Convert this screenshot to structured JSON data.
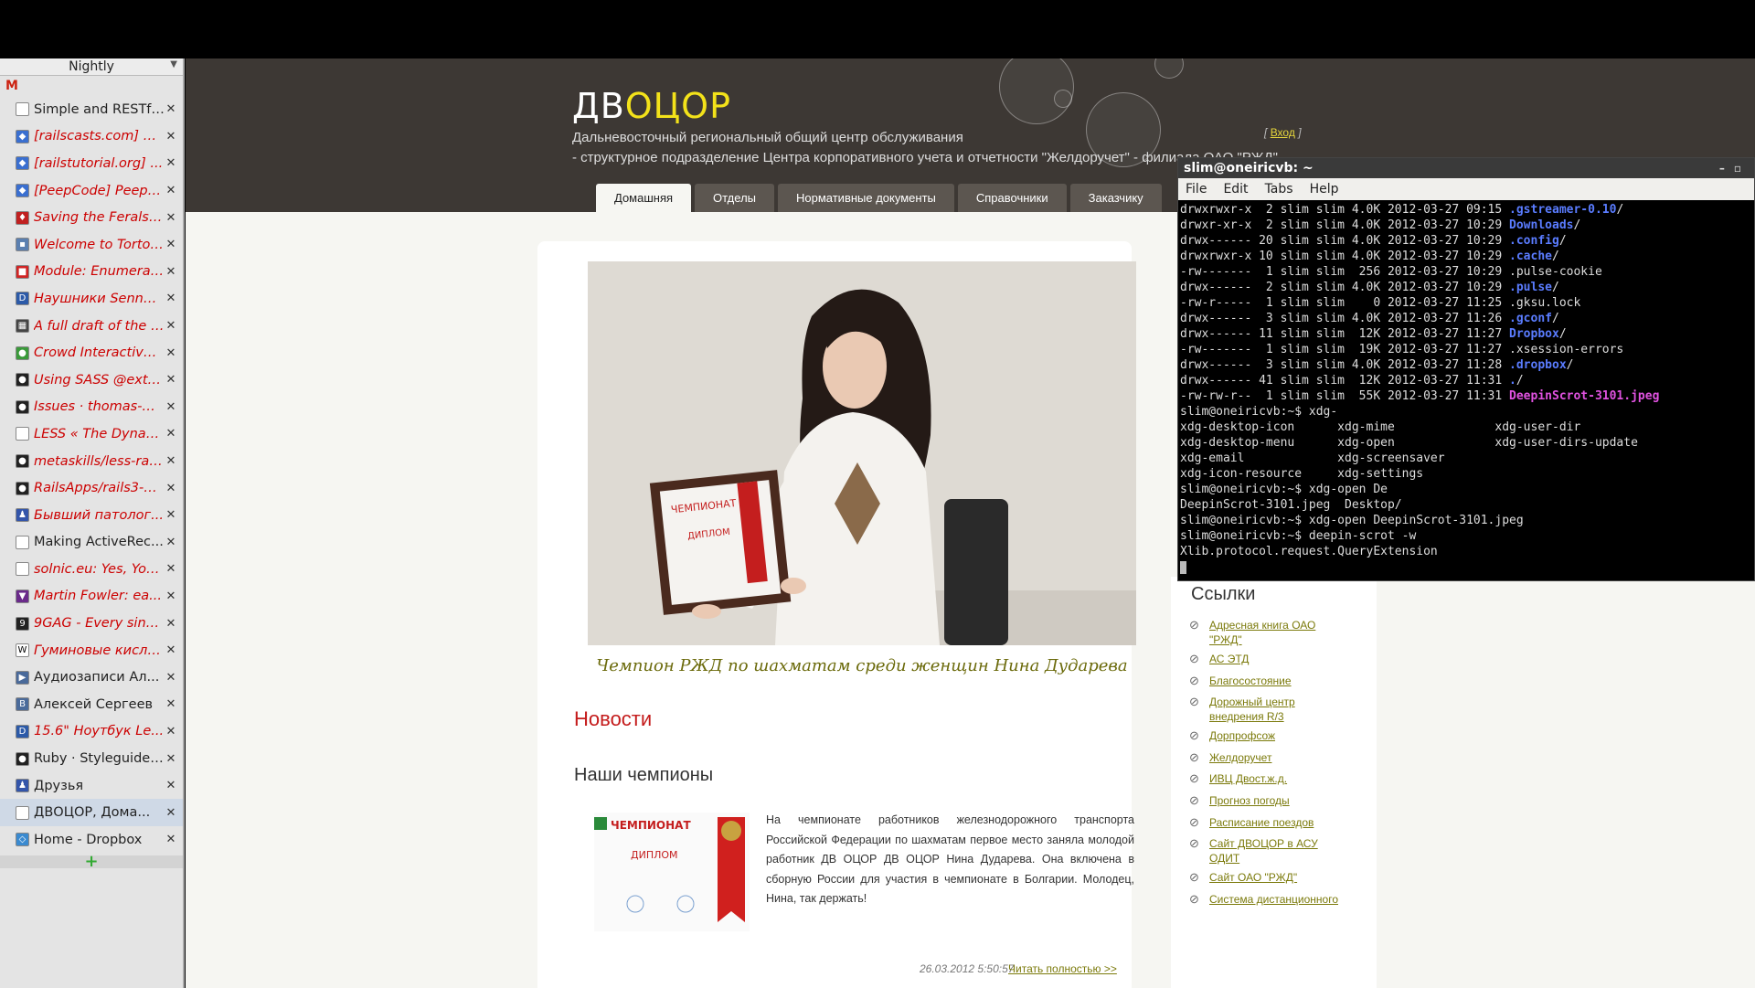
{
  "sidebar": {
    "header": "Nightly",
    "tabs": [
      {
        "title": "Simple and RESTful...",
        "italic": false,
        "icon": "page-icon",
        "color": "#ffffff"
      },
      {
        "title": "[railscasts.com] Ra...",
        "italic": true,
        "icon": "ruby-icon",
        "color": "#3a6fd0"
      },
      {
        "title": "[railstutorial.org] ...",
        "italic": true,
        "icon": "ruby-icon",
        "color": "#3a6fd0"
      },
      {
        "title": "[PeepCode] Peepc...",
        "italic": true,
        "icon": "ruby-icon",
        "color": "#3a6fd0"
      },
      {
        "title": "Saving the Ferals ...",
        "italic": true,
        "icon": "ferals-icon",
        "color": "#c02020"
      },
      {
        "title": "Welcome to Tortoi...",
        "italic": true,
        "icon": "tortoise-icon",
        "color": "#5a7fb0"
      },
      {
        "title": "Module: Enumerab...",
        "italic": true,
        "icon": "module-icon",
        "color": "#d02525"
      },
      {
        "title": "Наушники Sennhe...",
        "italic": true,
        "icon": "dns-icon",
        "color": "#2c5aa8"
      },
      {
        "title": "A full draft of the R...",
        "italic": true,
        "icon": "grid-icon",
        "color": "#444444"
      },
      {
        "title": "Crowd Interactive ...",
        "italic": true,
        "icon": "globe-icon",
        "color": "#3a9a3a"
      },
      {
        "title": "Using SASS @exte...",
        "italic": true,
        "icon": "github-icon",
        "color": "#222222"
      },
      {
        "title": "Issues · thomas-mc...",
        "italic": true,
        "icon": "github-icon",
        "color": "#222222"
      },
      {
        "title": "LESS « The Dynami...",
        "italic": true,
        "icon": "page-icon",
        "color": "#ffffff"
      },
      {
        "title": "metaskills/less-rail...",
        "italic": true,
        "icon": "github-icon",
        "color": "#222222"
      },
      {
        "title": "RailsApps/rails3-d...",
        "italic": true,
        "icon": "github-icon",
        "color": "#222222"
      },
      {
        "title": "Бывший патолог...",
        "italic": true,
        "icon": "user-icon",
        "color": "#3355aa"
      },
      {
        "title": "Making ActiveRec...",
        "italic": false,
        "icon": "page-icon",
        "color": "#ffffff"
      },
      {
        "title": "solnic.eu: Yes, You ...",
        "italic": true,
        "icon": "page-icon",
        "color": "#ffffff"
      },
      {
        "title": "Martin Fowler: ea...",
        "italic": true,
        "icon": "fowler-icon",
        "color": "#6a2a8a"
      },
      {
        "title": "9GAG - Every singl...",
        "italic": true,
        "icon": "9gag-icon",
        "color": "#222222"
      },
      {
        "title": "Гуминовые кисло...",
        "italic": true,
        "icon": "wikipedia-icon",
        "color": "#ffffff"
      },
      {
        "title": "Аудиозаписи Ал...",
        "italic": false,
        "icon": "audio-icon",
        "color": "#4a6a9a"
      },
      {
        "title": "Алексей Сергеев",
        "italic": false,
        "icon": "vk-icon",
        "color": "#4a6a9a"
      },
      {
        "title": "15.6\" Ноутбук Le...",
        "italic": true,
        "icon": "dns-icon",
        "color": "#2c5aa8"
      },
      {
        "title": "Ruby · Styleguide ...",
        "italic": false,
        "icon": "github-icon",
        "color": "#222222"
      },
      {
        "title": "Друзья",
        "italic": false,
        "icon": "user-icon",
        "color": "#3355aa"
      },
      {
        "title": "ДВОЦОР, Дома...",
        "italic": false,
        "icon": "page-icon",
        "color": "#ffffff",
        "active": true
      },
      {
        "title": "Home - Dropbox",
        "italic": false,
        "icon": "dropbox-icon",
        "color": "#3a8ad0"
      }
    ],
    "add_label": "+"
  },
  "site": {
    "title_white": "ДВ",
    "title_yellow": "ОЦОР",
    "subtitle1": "Дальневосточный региональный общий центр обслуживания",
    "subtitle2": "- структурное подразделение Центра корпоративного учета и отчетности \"Желдоручет\" - филиала ОАО \"РЖД\"",
    "login_prefix": "[",
    "login": "Вход",
    "login_suffix": "]",
    "nav": [
      "Домашняя",
      "Отделы",
      "Нормативные документы",
      "Справочники",
      "Заказчику"
    ]
  },
  "content": {
    "caption": "Чемпион РЖД по шахматам среди женщин Нина Дударева",
    "news_heading": "Новости",
    "article_title": "Наши чемпионы",
    "article_text": "На чемпионате работников железнодорожного транспорта Российской Федерации по шахматам первое место заняла молодой работник ДВ ОЦОР ДВ ОЦОР Нина Дударева. Она включена в сборную России для участия в чемпионате в Болгарии. Молодец, Нина, так держать!",
    "date": "26.03.2012 5:50:57",
    "read_more": "Читать полностью >>",
    "diploma_title": "ЧЕМПИОНАТ",
    "diploma_label": "ДИПЛОМ"
  },
  "links": {
    "heading": "Ссылки",
    "items": [
      "Адресная книга ОАО \"РЖД\"",
      "АС ЭТД",
      "Благосостояние",
      "Дорожный центр внедрения R/3",
      "Дорпрофсож",
      "Желдоручет",
      "ИВЦ Двост.ж.д.",
      "Прогноз погоды",
      "Расписание поездов",
      "Сайт ДВОЦОР в АСУ ОДИТ",
      "Сайт ОАО \"РЖД\"",
      "Система дистанционного"
    ]
  },
  "terminal": {
    "title": "slim@oneiricvb: ~",
    "menu": [
      "File",
      "Edit",
      "Tabs",
      "Help"
    ],
    "lines": [
      {
        "pre": "drwxrwxr-x  2 slim slim 4.0K 2012-03-27 09:15 ",
        "name": ".gstreamer-0.10",
        "cls": "dirc",
        "post": "/"
      },
      {
        "pre": "drwxr-xr-x  2 slim slim 4.0K 2012-03-27 10:29 ",
        "name": "Downloads",
        "cls": "dirc",
        "post": "/"
      },
      {
        "pre": "drwx------ 20 slim slim 4.0K 2012-03-27 10:29 ",
        "name": ".config",
        "cls": "dirc",
        "post": "/"
      },
      {
        "pre": "drwxrwxr-x 10 slim slim 4.0K 2012-03-27 10:29 ",
        "name": ".cache",
        "cls": "dirc",
        "post": "/"
      },
      {
        "pre": "-rw-------  1 slim slim  256 2012-03-27 10:29 .pulse-cookie",
        "name": "",
        "cls": "",
        "post": ""
      },
      {
        "pre": "drwx------  2 slim slim 4.0K 2012-03-27 10:29 ",
        "name": ".pulse",
        "cls": "dirc",
        "post": "/"
      },
      {
        "pre": "-rw-r-----  1 slim slim    0 2012-03-27 11:25 .gksu.lock",
        "name": "",
        "cls": "",
        "post": ""
      },
      {
        "pre": "drwx------  3 slim slim 4.0K 2012-03-27 11:26 ",
        "name": ".gconf",
        "cls": "dirc",
        "post": "/"
      },
      {
        "pre": "drwx------ 11 slim slim  12K 2012-03-27 11:27 ",
        "name": "Dropbox",
        "cls": "dirc",
        "post": "/"
      },
      {
        "pre": "-rw-------  1 slim slim  19K 2012-03-27 11:27 .xsession-errors",
        "name": "",
        "cls": "",
        "post": ""
      },
      {
        "pre": "drwx------  3 slim slim 4.0K 2012-03-27 11:28 ",
        "name": ".dropbox",
        "cls": "dirc",
        "post": "/"
      },
      {
        "pre": "drwx------ 41 slim slim  12K 2012-03-27 11:31 ",
        "name": ".",
        "cls": "dirc",
        "post": "/"
      },
      {
        "pre": "-rw-rw-r--  1 slim slim  55K 2012-03-27 11:31 ",
        "name": "DeepinScrot-3101.jpeg",
        "cls": "imgc",
        "post": ""
      },
      {
        "pre": "slim@oneiricvb:~$ xdg-",
        "name": "",
        "cls": "",
        "post": ""
      },
      {
        "pre": "xdg-desktop-icon      xdg-mime              xdg-user-dir",
        "name": "",
        "cls": "",
        "post": ""
      },
      {
        "pre": "xdg-desktop-menu      xdg-open              xdg-user-dirs-update",
        "name": "",
        "cls": "",
        "post": ""
      },
      {
        "pre": "xdg-email             xdg-screensaver",
        "name": "",
        "cls": "",
        "post": ""
      },
      {
        "pre": "xdg-icon-resource     xdg-settings",
        "name": "",
        "cls": "",
        "post": ""
      },
      {
        "pre": "slim@oneiricvb:~$ xdg-open De",
        "name": "",
        "cls": "",
        "post": ""
      },
      {
        "pre": "DeepinScrot-3101.jpeg  Desktop/",
        "name": "",
        "cls": "",
        "post": ""
      },
      {
        "pre": "slim@oneiricvb:~$ xdg-open DeepinScrot-3101.jpeg",
        "name": "",
        "cls": "",
        "post": ""
      },
      {
        "pre": "slim@oneiricvb:~$ deepin-scrot -w",
        "name": "",
        "cls": "",
        "post": ""
      },
      {
        "pre": "Xlib.protocol.request.QueryExtension",
        "name": "",
        "cls": "",
        "post": ""
      }
    ]
  }
}
